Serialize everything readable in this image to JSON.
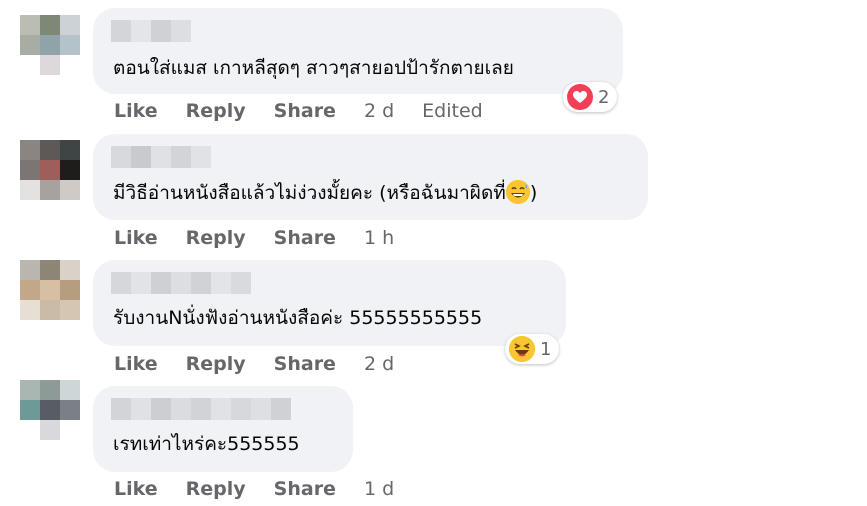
{
  "colors": {
    "bubble_bg": "#f0f2f5",
    "action_text": "#65676b",
    "heart": "#f33e58",
    "emoji_yellow": "#f7c630"
  },
  "actions": {
    "like": "Like",
    "reply": "Reply",
    "share": "Share"
  },
  "comments": [
    {
      "text": "ตอนใส่แมส เกาหลีสุดๆ สาวๆสายอปป้ารักตายเลย",
      "time": "2 d",
      "edited": "Edited",
      "reaction": {
        "icon": "heart-icon",
        "count": "2"
      }
    },
    {
      "text": "มีวิธีอ่านหนังสือแล้วไม่ง่วงมั้ยคะ (หรือฉันมาผิดที่",
      "text_suffix": ")",
      "inline_emoji": "grinning-sweat-emoji",
      "time": "1 h"
    },
    {
      "text": "รับงานNนั่งฟังอ่านหนังสือค่ะ 55555555555",
      "time": "2 d",
      "reaction": {
        "icon": "laughing-emoji-icon",
        "count": "1"
      }
    },
    {
      "text": "เรทเท่าไหร่คะ555555",
      "time": "1 d"
    }
  ]
}
